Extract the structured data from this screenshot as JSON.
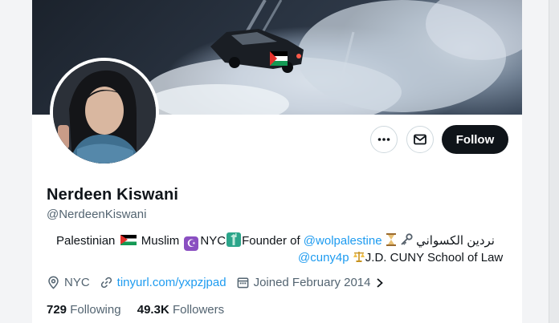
{
  "profile": {
    "name": "Nerdeen Kiswani",
    "handle": "@NerdeenKiswani",
    "bio": {
      "line1_part1": "Palestinian",
      "line1_part2": "Muslim",
      "line1_part3": "NYC",
      "line1_part4": "Founder of",
      "line1_mention": "@wolpalestine",
      "line1_arabic": "نردين الكسواني",
      "line2_mention": "@cuny4p",
      "line2_text": "J.D. CUNY School of Law"
    },
    "location": "NYC",
    "website": "tinyurl.com/yxpzjpad",
    "joined": "Joined February 2014",
    "following_count": "729",
    "following_label": "Following",
    "followers_count": "49.3K",
    "followers_label": "Followers"
  },
  "actions": {
    "more_icon": "more-icon",
    "message_icon": "envelope-icon",
    "follow_label": "Follow"
  },
  "colors": {
    "link": "#1d9bf0",
    "follow_bg": "#0f1419",
    "secondary_text": "#536471"
  }
}
